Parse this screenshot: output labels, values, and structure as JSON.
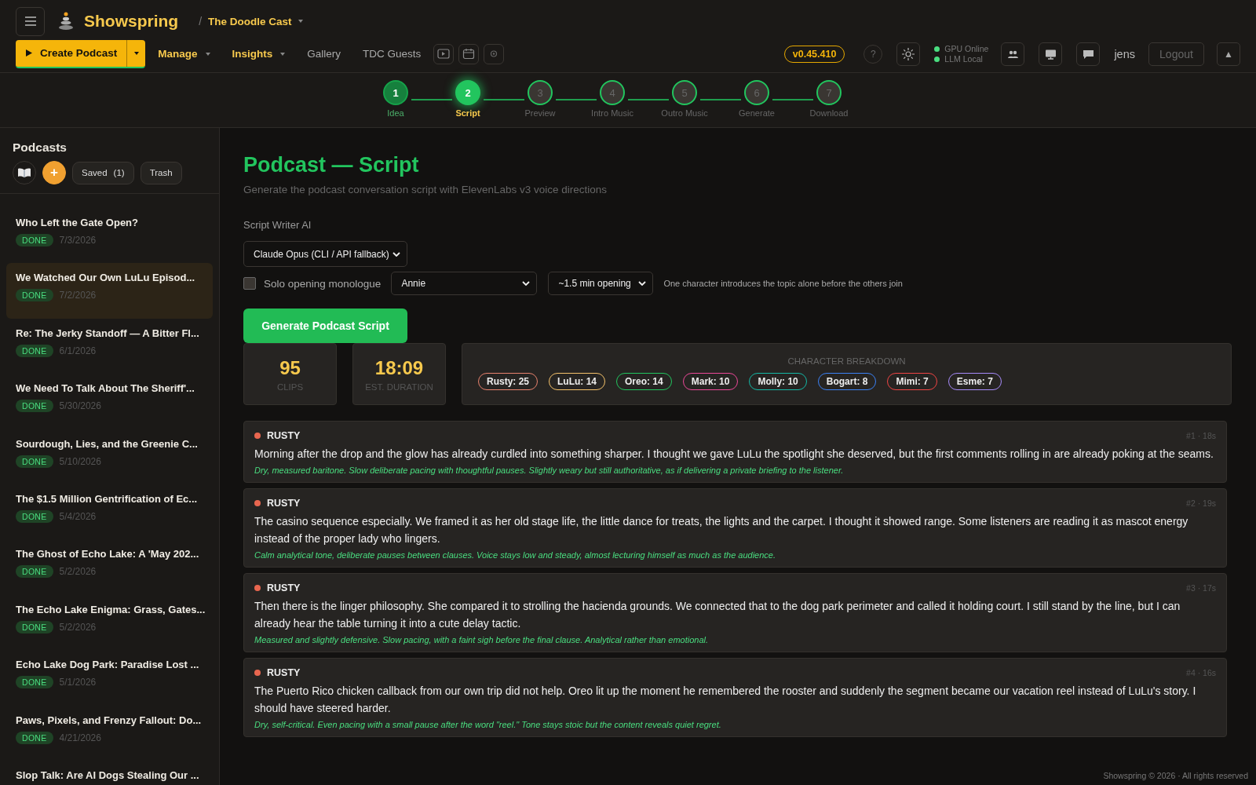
{
  "header": {
    "brand": "Showspring",
    "separator": "/",
    "workspace": "The Doodle Cast",
    "create_button": "Create Podcast",
    "nav": [
      {
        "label": "Manage",
        "kind": "menu"
      },
      {
        "label": "Insights",
        "kind": "menu"
      },
      {
        "label": "Gallery",
        "kind": "link"
      },
      {
        "label": "TDC Guests",
        "kind": "link"
      }
    ],
    "version": "v0.45.410",
    "help": "?",
    "status": [
      {
        "label": "GPU Online",
        "color": "#4ade80"
      },
      {
        "label": "LLM Local",
        "color": "#4ade80"
      }
    ],
    "user": "jens",
    "logout": "Logout",
    "collapse": "▲"
  },
  "steps": [
    {
      "number": "1",
      "label": "Idea",
      "done": true,
      "selected": false
    },
    {
      "number": "2",
      "label": "Script",
      "done": false,
      "selected": true
    },
    {
      "number": "3",
      "label": "Preview",
      "done": false,
      "selected": false
    },
    {
      "number": "4",
      "label": "Intro Music",
      "done": false,
      "selected": false
    },
    {
      "number": "5",
      "label": "Outro Music",
      "done": false,
      "selected": false
    },
    {
      "number": "6",
      "label": "Generate",
      "done": false,
      "selected": false
    },
    {
      "number": "7",
      "label": "Download",
      "done": false,
      "selected": false
    }
  ],
  "sidebar": {
    "title": "Podcasts",
    "add": "+",
    "saved": "Saved",
    "saved_count": "(1)",
    "trash": "Trash",
    "items": [
      {
        "title": "Who Left the Gate Open?",
        "status": "DONE",
        "date": "7/3/2026",
        "selected": false
      },
      {
        "title": "We Watched Our Own LuLu Episod...",
        "status": "DONE",
        "date": "7/2/2026",
        "selected": true
      },
      {
        "title": "Re: The Jerky Standoff — A Bitter Fl...",
        "status": "DONE",
        "date": "6/1/2026",
        "selected": false
      },
      {
        "title": "We Need To Talk About The Sheriff'...",
        "status": "DONE",
        "date": "5/30/2026",
        "selected": false
      },
      {
        "title": "Sourdough, Lies, and the Greenie C...",
        "status": "DONE",
        "date": "5/10/2026",
        "selected": false
      },
      {
        "title": "The $1.5 Million Gentrification of Ec...",
        "status": "DONE",
        "date": "5/4/2026",
        "selected": false
      },
      {
        "title": "The Ghost of Echo Lake: A 'May 202...",
        "status": "DONE",
        "date": "5/2/2026",
        "selected": false
      },
      {
        "title": "The Echo Lake Enigma: Grass, Gates...",
        "status": "DONE",
        "date": "5/2/2026",
        "selected": false
      },
      {
        "title": "Echo Lake Dog Park: Paradise Lost ...",
        "status": "DONE",
        "date": "5/1/2026",
        "selected": false
      },
      {
        "title": "Paws, Pixels, and Frenzy Fallout: Do...",
        "status": "DONE",
        "date": "4/21/2026",
        "selected": false
      },
      {
        "title": "Slop Talk: Are AI Dogs Stealing Our ...",
        "selected": false
      }
    ]
  },
  "main": {
    "title": "Podcast — Script",
    "subtitle": "Generate the podcast conversation script with ElevenLabs v3 voice directions",
    "writer_label": "Script Writer AI",
    "writer_value": "Claude Opus (CLI / API fallback)",
    "solo": {
      "label": "Solo opening monologue",
      "checked": false,
      "character": "Annie",
      "length": "~1.5 min opening",
      "hint": "One character introduces the topic alone before the others join"
    },
    "generate_button": "Generate Podcast Script",
    "stats": [
      {
        "value": "95",
        "label": "CLIPS"
      },
      {
        "value": "18:09",
        "label": "EST. DURATION"
      }
    ],
    "breakdown_title": "CHARACTER BREAKDOWN",
    "characters": [
      {
        "label": "Rusty: 25",
        "color": "#e8826e"
      },
      {
        "label": "LuLu: 14",
        "color": "#f5c26b"
      },
      {
        "label": "Oreo: 14",
        "color": "#22c55e"
      },
      {
        "label": "Mark: 10",
        "color": "#ec4899"
      },
      {
        "label": "Molly: 10",
        "color": "#14b8a6"
      },
      {
        "label": "Bogart: 8",
        "color": "#3b82f6"
      },
      {
        "label": "Mimi: 7",
        "color": "#ef4444"
      },
      {
        "label": "Esme: 7",
        "color": "#a78bfa"
      }
    ],
    "segments": [
      {
        "speaker": "RUSTY",
        "color": "#e8664f",
        "meta": "#1 · 18s",
        "text": "Morning after the drop and the glow has already curdled into something sharper. I thought we gave LuLu the spotlight she deserved, but the first comments rolling in are already poking at the seams.",
        "direction": "Dry, measured baritone. Slow deliberate pacing with thoughtful pauses. Slightly weary but still authoritative, as if delivering a private briefing to the listener."
      },
      {
        "speaker": "RUSTY",
        "color": "#e8664f",
        "meta": "#2 · 19s",
        "text": "The casino sequence especially. We framed it as her old stage life, the little dance for treats, the lights and the carpet. I thought it showed range. Some listeners are reading it as mascot energy instead of the proper lady who lingers.",
        "direction": "Calm analytical tone, deliberate pauses between clauses. Voice stays low and steady, almost lecturing himself as much as the audience."
      },
      {
        "speaker": "RUSTY",
        "color": "#e8664f",
        "meta": "#3 · 17s",
        "text": "Then there is the linger philosophy. She compared it to strolling the hacienda grounds. We connected that to the dog park perimeter and called it holding court. I still stand by the line, but I can already hear the table turning it into a cute delay tactic.",
        "direction": "Measured and slightly defensive. Slow pacing, with a faint sigh before the final clause. Analytical rather than emotional."
      },
      {
        "speaker": "RUSTY",
        "color": "#e8664f",
        "meta": "#4 · 16s",
        "text": "The Puerto Rico chicken callback from our own trip did not help. Oreo lit up the moment he remembered the rooster and suddenly the segment became our vacation reel instead of LuLu's story. I should have steered harder.",
        "direction": "Dry, self-critical. Even pacing with a small pause after the word \"reel.\" Tone stays stoic but the content reveals quiet regret."
      }
    ]
  },
  "footer": "Showspring © 2026 · All rights reserved"
}
